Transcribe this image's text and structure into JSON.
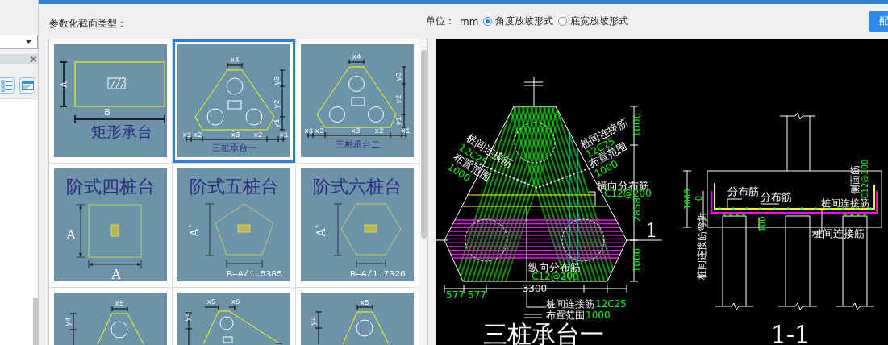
{
  "section_type_label": "参数化截面类型：",
  "unit": {
    "label": "单位：",
    "value": "mm"
  },
  "slope_modes": [
    {
      "label": "角度放坡形式",
      "selected": true
    },
    {
      "label": "底宽放坡形式",
      "selected": false
    }
  ],
  "action_button": {
    "label": "配"
  },
  "section_types": [
    {
      "kind": "rect",
      "selected": false,
      "caption": "矩形承台",
      "dim_labels": [
        "A",
        "B"
      ]
    },
    {
      "kind": "tri-a",
      "selected": true,
      "caption": "三桩承台一",
      "dim_labels": [
        "x4",
        "y3",
        "y2",
        "y1",
        "x1",
        "x2",
        "x3",
        "x2",
        "x1"
      ]
    },
    {
      "kind": "tri-b",
      "selected": false,
      "caption": "三桩承台二",
      "dim_labels": [
        "x4",
        "y3",
        "y2",
        "y1",
        "x1",
        "x2",
        "x3",
        "x2",
        "x1"
      ]
    },
    {
      "kind": "step-square",
      "selected": false,
      "caption": "阶式四桩台",
      "dim_labels": [
        "A",
        "A"
      ]
    },
    {
      "kind": "step-pentagon",
      "selected": false,
      "caption": "阶式五桩台",
      "dim_labels": [
        "A`",
        "B=A/1.5385"
      ]
    },
    {
      "kind": "step-hexagon",
      "selected": false,
      "caption": "阶式六桩台",
      "dim_labels": [
        "A`",
        "B=A/1.7326"
      ]
    },
    {
      "kind": "tri-c",
      "selected": false,
      "dim_labels": [
        "x5",
        "y4"
      ]
    },
    {
      "kind": "skew",
      "selected": false,
      "dim_labels": [
        "x5",
        "x6",
        "y4"
      ]
    },
    {
      "kind": "tri-d",
      "selected": false,
      "dim_labels": [
        "x5",
        "y4"
      ]
    }
  ],
  "plan_view": {
    "title": "三桩承台一",
    "section_mark": "1",
    "labels": [
      {
        "text": "桩间连接筋",
        "kind": "name"
      },
      {
        "text": "12C25",
        "kind": "spec"
      },
      {
        "text": "布置范围",
        "kind": "name"
      },
      {
        "text": "1000",
        "kind": "spec"
      },
      {
        "text": "桩间连接筋",
        "kind": "name"
      },
      {
        "text": "12C25",
        "kind": "spec"
      },
      {
        "text": "布置范围",
        "kind": "name"
      },
      {
        "text": "1000",
        "kind": "spec"
      },
      {
        "text": "横向分布筋",
        "kind": "name"
      },
      {
        "text": "C12@200",
        "kind": "spec"
      },
      {
        "text": "纵向分布筋",
        "kind": "name"
      },
      {
        "text": "C12@200",
        "kind": "spec"
      },
      {
        "text": "桩间连接筋",
        "kind": "name"
      },
      {
        "text": "12C25",
        "kind": "spec"
      },
      {
        "text": "布置范围",
        "kind": "name"
      },
      {
        "text": "1000",
        "kind": "spec"
      }
    ],
    "right_dims": [
      "1000",
      "2858",
      "1000"
    ],
    "bottom_dims": [
      "577",
      "577",
      "3300"
    ]
  },
  "section_view": {
    "title": "1-1",
    "labels": [
      {
        "text": "分布筋",
        "kind": "name"
      },
      {
        "text": "分布筋",
        "kind": "name"
      },
      {
        "text": "桩间连接筋",
        "kind": "name"
      },
      {
        "text": "桩间连接筋",
        "kind": "name"
      },
      {
        "text": "侧面筋",
        "kind": "name"
      },
      {
        "text": "C12@200",
        "kind": "spec"
      },
      {
        "text": "桩间连接筋弯折",
        "kind": "name"
      },
      {
        "text": "1000",
        "kind": "spec"
      },
      {
        "text": "0",
        "kind": "spec"
      },
      {
        "text": "100",
        "kind": "spec"
      }
    ]
  }
}
